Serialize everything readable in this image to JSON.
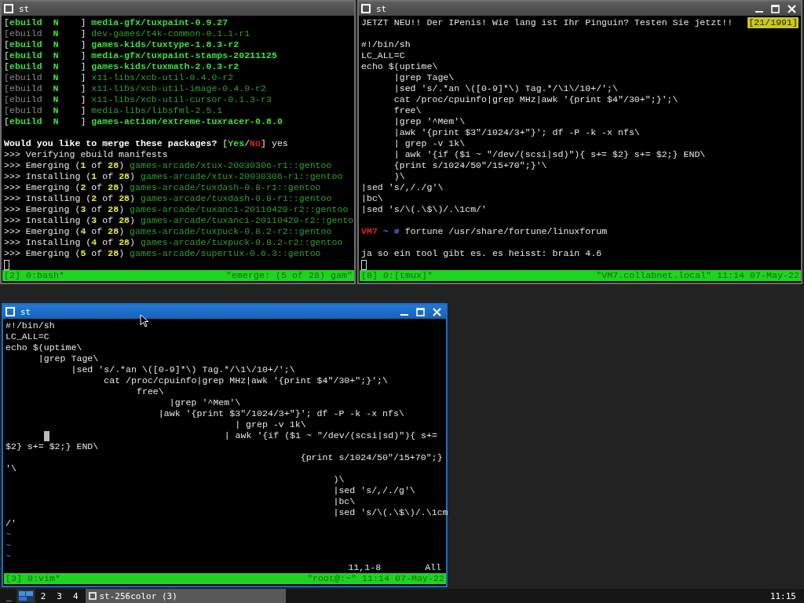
{
  "windows": [
    {
      "title": "st",
      "active": false,
      "controls": false,
      "lines": [
        {
          "kind": "text",
          "segments": [
            {
              "text": "[",
              "kind": "plain"
            },
            {
              "text": "ebuild  N",
              "kind": "green"
            },
            {
              "text": "    ] ",
              "kind": "plain"
            },
            {
              "text": "media-gfx/tuxpaint-0.9.27",
              "kind": "green"
            }
          ]
        },
        {
          "kind": "text",
          "segments": [
            {
              "text": "[ebuild",
              "kind": "grey"
            },
            {
              "text": "  N",
              "kind": "green"
            },
            {
              "text": "    ] ",
              "kind": "plain"
            },
            {
              "text": "dev-games/t4k-common-0.1.1-r1",
              "kind": "dim-green"
            }
          ]
        },
        {
          "kind": "text",
          "segments": [
            {
              "text": "[",
              "kind": "plain"
            },
            {
              "text": "ebuild  N",
              "kind": "green"
            },
            {
              "text": "    ] ",
              "kind": "plain"
            },
            {
              "text": "games-kids/tuxtype-1.8.3-r2",
              "kind": "green"
            }
          ]
        },
        {
          "kind": "text",
          "segments": [
            {
              "text": "[",
              "kind": "plain"
            },
            {
              "text": "ebuild  N",
              "kind": "green"
            },
            {
              "text": "    ] ",
              "kind": "plain"
            },
            {
              "text": "media-gfx/tuxpaint-stamps-20211125",
              "kind": "green"
            }
          ]
        },
        {
          "kind": "text",
          "segments": [
            {
              "text": "[",
              "kind": "plain"
            },
            {
              "text": "ebuild  N",
              "kind": "green"
            },
            {
              "text": "    ] ",
              "kind": "plain"
            },
            {
              "text": "games-kids/tuxmath-2.0.3-r2",
              "kind": "green"
            }
          ]
        },
        {
          "kind": "text",
          "segments": [
            {
              "text": "[ebuild",
              "kind": "grey"
            },
            {
              "text": "  N",
              "kind": "green"
            },
            {
              "text": "    ] ",
              "kind": "plain"
            },
            {
              "text": "x11-libs/xcb-util-0.4.0-r2",
              "kind": "dim-green"
            }
          ]
        },
        {
          "kind": "text",
          "segments": [
            {
              "text": "[ebuild",
              "kind": "grey"
            },
            {
              "text": "  N",
              "kind": "green"
            },
            {
              "text": "    ] ",
              "kind": "plain"
            },
            {
              "text": "x11-libs/xcb-util-image-0.4.0-r2",
              "kind": "dim-green"
            }
          ]
        },
        {
          "kind": "text",
          "segments": [
            {
              "text": "[ebuild",
              "kind": "grey"
            },
            {
              "text": "  N",
              "kind": "green"
            },
            {
              "text": "    ] ",
              "kind": "plain"
            },
            {
              "text": "x11-libs/xcb-util-cursor-0.1.3-r3",
              "kind": "dim-green"
            }
          ]
        },
        {
          "kind": "text",
          "segments": [
            {
              "text": "[ebuild",
              "kind": "grey"
            },
            {
              "text": "  N",
              "kind": "green"
            },
            {
              "text": "    ] ",
              "kind": "plain"
            },
            {
              "text": "media-libs/libsfml-2.5.1",
              "kind": "dim-green"
            }
          ]
        },
        {
          "kind": "text",
          "segments": [
            {
              "text": "[",
              "kind": "plain"
            },
            {
              "text": "ebuild  N",
              "kind": "green"
            },
            {
              "text": "    ] ",
              "kind": "plain"
            },
            {
              "text": "games-action/extreme-tuxracer-0.8.0",
              "kind": "green"
            }
          ]
        },
        {
          "kind": "blank"
        },
        {
          "kind": "text",
          "segments": [
            {
              "text": "Would you like to merge these packages? ",
              "kind": "bold"
            },
            {
              "text": "[",
              "kind": "plain"
            },
            {
              "text": "Yes",
              "kind": "green"
            },
            {
              "text": "/",
              "kind": "plain"
            },
            {
              "text": "No",
              "kind": "red"
            },
            {
              "text": "] yes",
              "kind": "plain"
            }
          ]
        },
        {
          "kind": "text",
          "segments": [
            {
              "text": ">>> Verifying ebuild manifests",
              "kind": "plain"
            }
          ]
        },
        {
          "kind": "text",
          "segments": [
            {
              "text": ">>> Emerging (",
              "kind": "plain"
            },
            {
              "text": "1",
              "kind": "yellow"
            },
            {
              "text": " of ",
              "kind": "plain"
            },
            {
              "text": "28",
              "kind": "yellow"
            },
            {
              "text": ") ",
              "kind": "plain"
            },
            {
              "text": "games-arcade/xtux-20030306-r1::gentoo",
              "kind": "dim-green"
            }
          ]
        },
        {
          "kind": "text",
          "segments": [
            {
              "text": ">>> Installing (",
              "kind": "plain"
            },
            {
              "text": "1",
              "kind": "yellow"
            },
            {
              "text": " of ",
              "kind": "plain"
            },
            {
              "text": "28",
              "kind": "yellow"
            },
            {
              "text": ") ",
              "kind": "plain"
            },
            {
              "text": "games-arcade/xtux-20030306-r1::gentoo",
              "kind": "dim-green"
            }
          ]
        },
        {
          "kind": "text",
          "segments": [
            {
              "text": ">>> Emerging (",
              "kind": "plain"
            },
            {
              "text": "2",
              "kind": "yellow"
            },
            {
              "text": " of ",
              "kind": "plain"
            },
            {
              "text": "28",
              "kind": "yellow"
            },
            {
              "text": ") ",
              "kind": "plain"
            },
            {
              "text": "games-arcade/tuxdash-0.8-r1::gentoo",
              "kind": "dim-green"
            }
          ]
        },
        {
          "kind": "text",
          "segments": [
            {
              "text": ">>> Installing (",
              "kind": "plain"
            },
            {
              "text": "2",
              "kind": "yellow"
            },
            {
              "text": " of ",
              "kind": "plain"
            },
            {
              "text": "28",
              "kind": "yellow"
            },
            {
              "text": ") ",
              "kind": "plain"
            },
            {
              "text": "games-arcade/tuxdash-0.8-r1::gentoo",
              "kind": "dim-green"
            }
          ]
        },
        {
          "kind": "text",
          "segments": [
            {
              "text": ">>> Emerging (",
              "kind": "plain"
            },
            {
              "text": "3",
              "kind": "yellow"
            },
            {
              "text": " of ",
              "kind": "plain"
            },
            {
              "text": "28",
              "kind": "yellow"
            },
            {
              "text": ") ",
              "kind": "plain"
            },
            {
              "text": "games-arcade/tuxanci-20110429-r2::gentoo",
              "kind": "dim-green"
            }
          ]
        },
        {
          "kind": "text",
          "segments": [
            {
              "text": ">>> Installing (",
              "kind": "plain"
            },
            {
              "text": "3",
              "kind": "yellow"
            },
            {
              "text": " of ",
              "kind": "plain"
            },
            {
              "text": "28",
              "kind": "yellow"
            },
            {
              "text": ") ",
              "kind": "plain"
            },
            {
              "text": "games-arcade/tuxanci-20110429-r2::gento",
              "kind": "dim-green"
            }
          ]
        },
        {
          "kind": "text",
          "segments": [
            {
              "text": ">>> Emerging (",
              "kind": "plain"
            },
            {
              "text": "4",
              "kind": "yellow"
            },
            {
              "text": " of ",
              "kind": "plain"
            },
            {
              "text": "28",
              "kind": "yellow"
            },
            {
              "text": ") ",
              "kind": "plain"
            },
            {
              "text": "games-arcade/tuxpuck-0.8.2-r2::gentoo",
              "kind": "dim-green"
            }
          ]
        },
        {
          "kind": "text",
          "segments": [
            {
              "text": ">>> Installing (",
              "kind": "plain"
            },
            {
              "text": "4",
              "kind": "yellow"
            },
            {
              "text": " of ",
              "kind": "plain"
            },
            {
              "text": "28",
              "kind": "yellow"
            },
            {
              "text": ") ",
              "kind": "plain"
            },
            {
              "text": "games-arcade/tuxpuck-0.8.2-r2::gentoo",
              "kind": "dim-green"
            }
          ]
        },
        {
          "kind": "text",
          "segments": [
            {
              "text": ">>> Emerging (",
              "kind": "plain"
            },
            {
              "text": "5",
              "kind": "yellow"
            },
            {
              "text": " of ",
              "kind": "plain"
            },
            {
              "text": "28",
              "kind": "yellow"
            },
            {
              "text": ") ",
              "kind": "plain"
            },
            {
              "text": "games-arcade/supertux-0.6.3::gentoo",
              "kind": "dim-green"
            }
          ]
        },
        {
          "kind": "text",
          "segments": [
            {
              "kind": "hollow-cursor"
            }
          ]
        }
      ],
      "status": {
        "left": "[2] 0:bash*",
        "right": "\"emerge: (5 of 28) gam\""
      }
    },
    {
      "title": "st",
      "active": false,
      "controls": true,
      "lines": [
        {
          "kind": "text",
          "segments": [
            {
              "text": "JETZT NEU!! Der IPenis! Wie lang ist Ihr Pinguin? Testen Sie jetzt!!",
              "kind": "plain"
            }
          ],
          "badge": "[21/1991]"
        },
        {
          "kind": "blank"
        },
        {
          "kind": "text",
          "segments": [
            {
              "text": "#!/bin/sh",
              "kind": "plain"
            }
          ]
        },
        {
          "kind": "text",
          "segments": [
            {
              "text": "LC_ALL=C",
              "kind": "plain"
            }
          ]
        },
        {
          "kind": "text",
          "segments": [
            {
              "text": "echo $(uptime\\",
              "kind": "plain"
            }
          ]
        },
        {
          "kind": "text",
          "segments": [
            {
              "text": "      |grep Tage\\",
              "kind": "plain"
            }
          ]
        },
        {
          "kind": "text",
          "segments": [
            {
              "text": "      |sed 's/.*an \\([0-9]*\\) Tag.*/\\1\\/10+/';\\",
              "kind": "plain"
            }
          ]
        },
        {
          "kind": "text",
          "segments": [
            {
              "text": "      cat /proc/cpuinfo|grep MHz|awk '{print $4\"/30+\";}';\\",
              "kind": "plain"
            }
          ]
        },
        {
          "kind": "text",
          "segments": [
            {
              "text": "      free\\",
              "kind": "plain"
            }
          ]
        },
        {
          "kind": "text",
          "segments": [
            {
              "text": "      |grep '^Mem'\\",
              "kind": "plain"
            }
          ]
        },
        {
          "kind": "text",
          "segments": [
            {
              "text": "      |awk '{print $3\"/1024/3+\"}'; df -P -k -x nfs\\",
              "kind": "plain"
            }
          ]
        },
        {
          "kind": "text",
          "segments": [
            {
              "text": "      | grep -v 1k\\",
              "kind": "plain"
            }
          ]
        },
        {
          "kind": "text",
          "segments": [
            {
              "text": "      | awk '{if ($1 ~ \"/dev/(scsi|sd)\"){ s+= $2} s+= $2;} END\\",
              "kind": "plain"
            }
          ]
        },
        {
          "kind": "text",
          "segments": [
            {
              "text": "      {print s/1024/50\"/15+70\";}'\\",
              "kind": "plain"
            }
          ]
        },
        {
          "kind": "text",
          "segments": [
            {
              "text": "      )\\",
              "kind": "plain"
            }
          ]
        },
        {
          "kind": "text",
          "segments": [
            {
              "text": "|sed 's/,/./g'\\",
              "kind": "plain"
            }
          ]
        },
        {
          "kind": "text",
          "segments": [
            {
              "text": "|bc\\",
              "kind": "plain"
            }
          ]
        },
        {
          "kind": "text",
          "segments": [
            {
              "text": "|sed 's/\\(.\\$\\)/.\\1cm/'",
              "kind": "plain"
            }
          ]
        },
        {
          "kind": "blank"
        },
        {
          "kind": "text",
          "segments": [
            {
              "text": "VM7",
              "kind": "red"
            },
            {
              "text": " ~ #",
              "kind": "blue"
            },
            {
              "text": " fortune /usr/share/fortune/linuxforum",
              "kind": "plain"
            }
          ]
        },
        {
          "kind": "blank"
        },
        {
          "kind": "text",
          "segments": [
            {
              "text": "ja so ein tool gibt es. es heisst: brain 4.6",
              "kind": "plain"
            }
          ]
        },
        {
          "kind": "text",
          "segments": [
            {
              "kind": "hollow-cursor"
            }
          ]
        }
      ],
      "status": {
        "left": "[8] 0:[tmux]*",
        "right": "\"VM7.collabnet.local\" 11:14 07-May-22"
      }
    },
    {
      "title": "st",
      "active": true,
      "controls": true,
      "lines": [
        {
          "kind": "text",
          "segments": [
            {
              "text": "#!/bin/sh",
              "kind": "plain"
            }
          ]
        },
        {
          "kind": "text",
          "segments": [
            {
              "text": "LC_ALL=C",
              "kind": "plain"
            }
          ]
        },
        {
          "kind": "text",
          "segments": [
            {
              "text": "echo $(uptime\\",
              "kind": "plain"
            }
          ]
        },
        {
          "kind": "text",
          "segments": [
            {
              "text": "      |grep Tage\\",
              "kind": "plain"
            }
          ]
        },
        {
          "kind": "text",
          "segments": [
            {
              "text": "            |sed 's/.*an \\([0-9]*\\) Tag.*/\\1\\/10+/';\\",
              "kind": "plain"
            }
          ]
        },
        {
          "kind": "text",
          "segments": [
            {
              "text": "                  cat /proc/cpuinfo|grep MHz|awk '{print $4\"/30+\";}';\\",
              "kind": "plain"
            }
          ]
        },
        {
          "kind": "text",
          "segments": [
            {
              "text": "                        free\\",
              "kind": "plain"
            }
          ]
        },
        {
          "kind": "text",
          "segments": [
            {
              "text": "                              |grep '^Mem'\\",
              "kind": "plain"
            }
          ]
        },
        {
          "kind": "text",
          "segments": [
            {
              "text": "                            |awk '{print $3\"/1024/3+\"}'; df -P -k -x nfs\\",
              "kind": "plain"
            }
          ]
        },
        {
          "kind": "text",
          "segments": [
            {
              "text": "                                          | grep -v 1k\\",
              "kind": "plain"
            }
          ]
        },
        {
          "kind": "text",
          "segments": [
            {
              "kind": "block-cursor"
            },
            {
              "text": "                                | awk '{if ($1 ~ \"/dev/(scsi|sd)\"){ s+=",
              "kind": "plain"
            }
          ]
        },
        {
          "kind": "text",
          "segments": [
            {
              "text": "$2} s+= $2;} END\\",
              "kind": "plain"
            }
          ]
        },
        {
          "kind": "text",
          "segments": [
            {
              "text": "                                                      {print s/1024/50\"/15+70\";}",
              "kind": "plain"
            }
          ]
        },
        {
          "kind": "text",
          "segments": [
            {
              "text": "'\\",
              "kind": "plain"
            }
          ]
        },
        {
          "kind": "text",
          "segments": [
            {
              "text": "                                                            )\\",
              "kind": "plain"
            }
          ]
        },
        {
          "kind": "text",
          "segments": [
            {
              "text": "                                                            |sed 's/,/./g'\\",
              "kind": "plain"
            }
          ]
        },
        {
          "kind": "text",
          "segments": [
            {
              "text": "                                                            |bc\\",
              "kind": "plain"
            }
          ]
        },
        {
          "kind": "text",
          "segments": [
            {
              "text": "                                                            |sed 's/\\(.\\$\\)/.\\1cm",
              "kind": "plain"
            }
          ]
        },
        {
          "kind": "text",
          "segments": [
            {
              "text": "/'",
              "kind": "plain"
            }
          ]
        },
        {
          "kind": "text",
          "segments": [
            {
              "text": "~",
              "kind": "tilde"
            }
          ]
        },
        {
          "kind": "text",
          "segments": [
            {
              "text": "~",
              "kind": "tilde"
            }
          ]
        },
        {
          "kind": "text",
          "segments": [
            {
              "text": "~",
              "kind": "tilde"
            }
          ]
        },
        {
          "kind": "ruler",
          "position": "11,1-8",
          "scroll": "All"
        }
      ],
      "status": {
        "left": "[3] 0:vim*",
        "right": "\"root@:~\" 11:14 07-May-22"
      }
    }
  ],
  "taskbar": {
    "show_desktop": "_",
    "workspaces": [
      {
        "kind": "pager",
        "selected": true
      },
      {
        "kind": "number",
        "label": "2",
        "selected": false
      },
      {
        "kind": "number",
        "label": "3",
        "selected": false
      },
      {
        "kind": "number",
        "label": "4",
        "selected": false
      }
    ],
    "tasks": [
      {
        "label": "st-256color (3)",
        "selected": true
      }
    ],
    "clock": "11:15"
  }
}
